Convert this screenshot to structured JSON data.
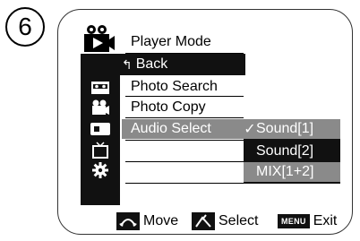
{
  "step_number": "6",
  "menu": {
    "title": "Player Mode",
    "back_label": "Back",
    "back_glyph": "↰",
    "items": [
      {
        "label": "Photo Search"
      },
      {
        "label": "Photo Copy"
      },
      {
        "label": "Audio Select"
      }
    ],
    "sidebar_icons": [
      "tape-icon",
      "camera-icon",
      "memory-card-icon",
      "tv-icon",
      "gear-icon"
    ]
  },
  "submenu": {
    "options": [
      {
        "label": "Sound[1]",
        "checked": true
      },
      {
        "label": "Sound[2]",
        "checked": false
      },
      {
        "label": "MIX[1+2]",
        "checked": false
      }
    ],
    "check_glyph": "✓"
  },
  "footer": {
    "move_label": "Move",
    "select_label": "Select",
    "exit_key_label": "MENU",
    "exit_label": "Exit"
  },
  "colors": {
    "highlight": "#8a8a8a",
    "dark": "#111111"
  }
}
